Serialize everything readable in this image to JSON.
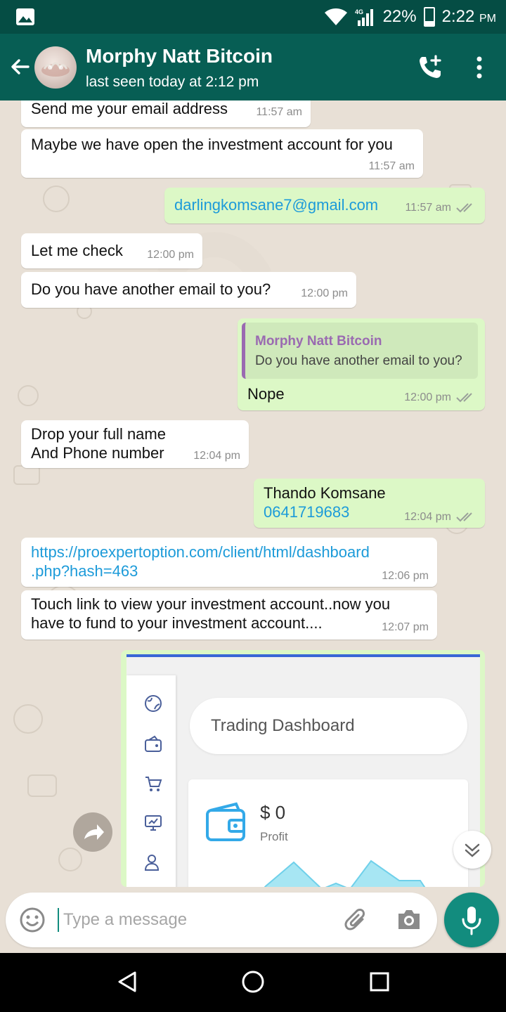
{
  "status_bar": {
    "network": "4G",
    "battery": "22%",
    "time": "2:22",
    "ampm": "PM"
  },
  "header": {
    "contact_name": "Morphy Natt Bitcoin",
    "last_seen": "last seen today at 2:12 pm",
    "icons": [
      "back-arrow-icon",
      "avatar",
      "add-call-icon",
      "more-vert-icon"
    ]
  },
  "messages": [
    {
      "dir": "in",
      "text": "Send me your email address",
      "time": "11:57 am"
    },
    {
      "dir": "in",
      "text": "Maybe we have open the investment account for you",
      "time": "11:57 am"
    },
    {
      "dir": "out",
      "text": "darlingkomsane7@gmail.com",
      "time": "11:57 am",
      "read": true,
      "is_link": true
    },
    {
      "dir": "in",
      "text": "Let me check",
      "time": "12:00 pm"
    },
    {
      "dir": "in",
      "text": "Do you have another email to you?",
      "time": "12:00 pm"
    },
    {
      "dir": "out",
      "quote_name": "Morphy Natt Bitcoin",
      "quote_text": "Do you have another email to you?",
      "text": "Nope",
      "time": "12:00 pm",
      "read": true
    },
    {
      "dir": "in",
      "text": "Drop your full name\nAnd Phone number",
      "time": "12:04 pm"
    },
    {
      "dir": "out",
      "text": "Thando Komsane",
      "text2": "0641719683",
      "time": "12:04 pm",
      "read": true
    },
    {
      "dir": "in",
      "text": "https://proexpertoption.com/client/html/dashboard\n.php?hash=463",
      "time": "12:06 pm",
      "is_link": true
    },
    {
      "dir": "in",
      "text": "Touch link to view your investment account..now you\nhave to fund to your investment account....",
      "time": "12:07 pm"
    }
  ],
  "image_message": {
    "dashboard_title": "Trading Dashboard",
    "profit_value": "$ 0",
    "profit_label": "Profit",
    "side_icons": [
      "globe-icon",
      "wallet-icon",
      "cart-icon",
      "monitor-icon",
      "user-icon"
    ]
  },
  "input": {
    "placeholder": "Type a message"
  },
  "colors": {
    "header": "#075e54",
    "status_bar": "#054d44",
    "outgoing": "#dcf8c6",
    "incoming": "#ffffff",
    "accent": "#128c7e",
    "link": "#1d9bd9",
    "read_tick": "#9aa09a"
  }
}
